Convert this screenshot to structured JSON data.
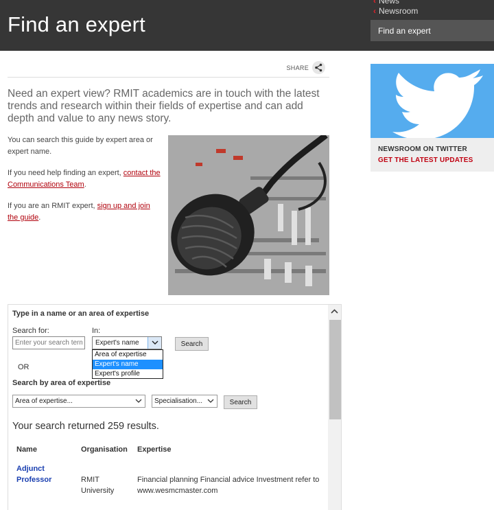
{
  "header": {
    "title": "Find an expert"
  },
  "side_nav": {
    "items": [
      {
        "label": "News"
      },
      {
        "label": "Newsroom"
      }
    ],
    "current": "Find an expert"
  },
  "share": {
    "label": "SHARE"
  },
  "intro": "Need an expert view? RMIT academics are in touch with the latest trends and research within their fields of expertise and can add depth and value to any news story.",
  "paragraphs": {
    "p1": "You can search this guide by expert area or expert name.",
    "p2_before": "If you need help finding an expert, ",
    "p2_link": "contact the Communications Team",
    "p2_after": ".",
    "p3_before": "If you are an RMIT expert, ",
    "p3_link": "sign up and join the guide",
    "p3_after": "."
  },
  "twitter": {
    "title": "NEWSROOM ON TWITTER",
    "link": "GET THE LATEST UPDATES"
  },
  "search": {
    "heading": "Type in a name or an area of expertise",
    "search_for_label": "Search for:",
    "in_label": "In:",
    "input_placeholder": "Enter your search term",
    "in_selected": "Expert's name",
    "in_options": [
      "Area of expertise",
      "Expert's name",
      "Expert's profile"
    ],
    "search_button": "Search",
    "or_label": "OR",
    "area_heading": "Search by area of expertise",
    "area_select": "Area of expertise...",
    "spec_select": "Specialisation...",
    "search_button_2": "Search"
  },
  "results": {
    "summary": "Your search returned 259 results.",
    "columns": [
      "Name",
      "Organisation",
      "Expertise"
    ],
    "rows": [
      {
        "name": "Adjunct Professor",
        "organisation": "RMIT University",
        "expertise": "Financial planning Financial advice Investment refer to www.wesmcmaster.com"
      }
    ]
  },
  "colors": {
    "header_bg": "#363636",
    "accent_red": "#c00010",
    "twitter_blue": "#55acee",
    "link_blue": "#1a3fb0",
    "selected_option": "#1e90ff"
  },
  "icons": {
    "share": "share-icon",
    "twitter": "twitter-bird-icon",
    "nav_chevron": "chevron-left-icon",
    "dropdown": "chevron-down-icon",
    "scroll_up": "arrow-up-icon"
  }
}
